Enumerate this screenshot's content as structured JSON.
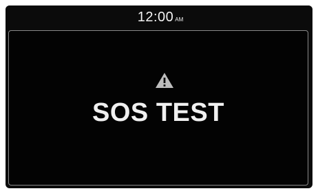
{
  "status_bar": {
    "time": "12:00",
    "ampm": "AM"
  },
  "alert": {
    "icon": "warning-triangle-icon",
    "message": "SOS TEST"
  },
  "colors": {
    "background": "#0b0b0b",
    "text": "#f0f0f0",
    "icon": "#bdbdbd",
    "panel_border": "#8a8a8a"
  }
}
